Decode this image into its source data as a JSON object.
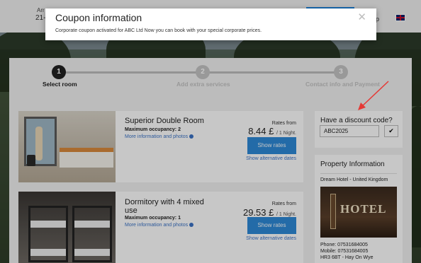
{
  "header": {
    "arrival_label": "Arr",
    "date_fragment": "21-",
    "language_fragment": "p"
  },
  "steps": [
    {
      "number": "1",
      "label": "Select room"
    },
    {
      "number": "2",
      "label": "Add extra services"
    },
    {
      "number": "3",
      "label": "Contact info and Payment"
    }
  ],
  "rooms": [
    {
      "name": "Superior Double Room",
      "occupancy": "Maximum occupancy: 2",
      "more_info": "More information and photos",
      "rates_from": "Rates from",
      "price": "8.44 £",
      "per": "/ 1 Night.",
      "button": "Show rates",
      "alt_dates": "Show alternative dates"
    },
    {
      "name": "Dormitory with 4 mixed use",
      "occupancy": "Maximum occupancy: 1",
      "more_info": "More information and photos",
      "rates_from": "Rates from",
      "price": "29.53 £",
      "per": "/ 1 Night.",
      "button": "Show rates",
      "alt_dates": "Show alternative dates"
    }
  ],
  "discount": {
    "label": "Have a discount code?",
    "value": "ABC2025",
    "apply_icon": "✔"
  },
  "property": {
    "title": "Property Information",
    "hotel": "Dream Hotel - United Kingdom",
    "sign_text": "HOTEL",
    "phone": "Phone: 07531684005",
    "mobile": "Mobile: 07531684005",
    "address": "HR3 6BT - Hay On Wye"
  },
  "modal": {
    "title": "Coupon information",
    "message": "Corporate coupon activated for ABC Ltd Now you can book with your special corporate prices.",
    "close_icon": "✕"
  },
  "colors": {
    "accent": "#2d8ad8",
    "link": "#3b73c6",
    "annotation_arrow": "#e53935"
  }
}
